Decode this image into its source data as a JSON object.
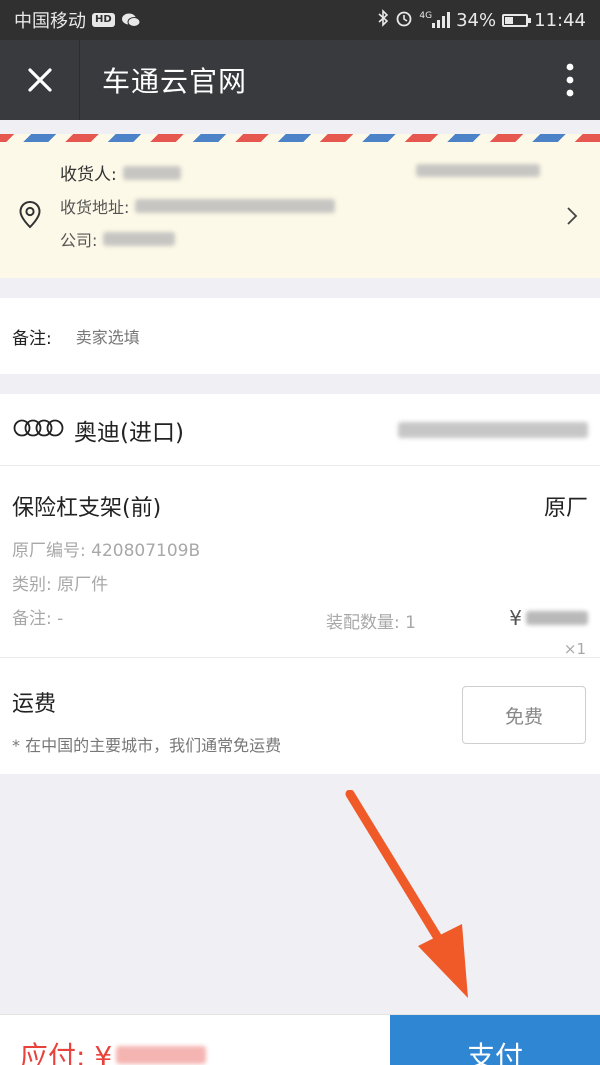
{
  "status_bar": {
    "carrier": "中国移动",
    "hd_badge": "HD",
    "network": "4G",
    "battery": "34%",
    "battery_level": 0.34,
    "time": "11:44",
    "icons": [
      "wechat-icon",
      "bluetooth-icon",
      "alarm-icon",
      "signal-icon",
      "battery-icon"
    ]
  },
  "nav": {
    "title": "车通云官网",
    "close_icon": "close-icon",
    "more_icon": "more-vertical-icon"
  },
  "address": {
    "recipient_label": "收货人:",
    "address_label": "收货地址:",
    "company_label": "公司:"
  },
  "remark": {
    "label": "备注:",
    "value": "卖家选填"
  },
  "product": {
    "brand_name": "奥迪(进口)",
    "brand_icon": "audi-rings-icon",
    "item_name": "保险杠支架(前)",
    "item_grade": "原厂",
    "part_number": "原厂编号: 420807109B",
    "quantity": "装配数量: 1",
    "category": "类别: 原厂件",
    "item_remark": "备注: -",
    "currency": "¥",
    "multiplier": "×1"
  },
  "shipping": {
    "title": "运费",
    "note": "* 在中国的主要城市，我们通常免运费",
    "button_label": "免费"
  },
  "footer": {
    "total_label": "应付: ¥",
    "pay_label": "支付"
  },
  "colors": {
    "nav_bg": "#393a3e",
    "status_bg": "#303030",
    "address_bg": "#fdf9e8",
    "pay_button": "#2f86d3",
    "total_text": "#e8423b",
    "arrow": "#f05a28"
  }
}
